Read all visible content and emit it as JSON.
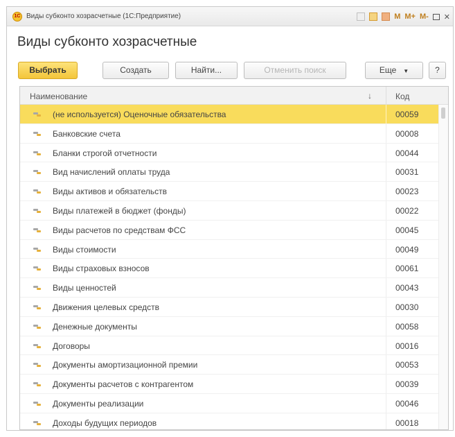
{
  "window": {
    "title": "Виды субконто хозрасчетные (1С:Предприятие)",
    "app_icon": "1c-logo-icon",
    "toolbar_icons": [
      "grid-icon",
      "calendar-icon",
      "calculator-icon"
    ],
    "memory_buttons": {
      "m": "M",
      "m_plus": "M+",
      "m_minus": "M-"
    },
    "minimize": "–",
    "close": "✕"
  },
  "form": {
    "title": "Виды субконто хозрасчетные"
  },
  "toolbar": {
    "select": "Выбрать",
    "create": "Создать",
    "find": "Найти...",
    "cancel_search": "Отменить поиск",
    "more": "Еще",
    "more_arrow": "▼",
    "help": "?"
  },
  "table": {
    "columns": {
      "name": "Наименование",
      "sort": "↓",
      "code": "Код"
    },
    "rows": [
      {
        "name": "(не используется) Оценочные обязательства",
        "code": "00059",
        "selected": true
      },
      {
        "name": "Банковские счета",
        "code": "00008"
      },
      {
        "name": "Бланки строгой отчетности",
        "code": "00044"
      },
      {
        "name": "Вид начислений оплаты труда",
        "code": "00031"
      },
      {
        "name": "Виды активов и обязательств",
        "code": "00023"
      },
      {
        "name": "Виды платежей в бюджет (фонды)",
        "code": "00022"
      },
      {
        "name": "Виды расчетов по средствам ФСС",
        "code": "00045"
      },
      {
        "name": "Виды стоимости",
        "code": "00049"
      },
      {
        "name": "Виды страховых взносов",
        "code": "00061"
      },
      {
        "name": "Виды ценностей",
        "code": "00043"
      },
      {
        "name": "Движения целевых средств",
        "code": "00030"
      },
      {
        "name": "Денежные документы",
        "code": "00058"
      },
      {
        "name": "Договоры",
        "code": "00016"
      },
      {
        "name": "Документы амортизационной премии",
        "code": "00053"
      },
      {
        "name": "Документы расчетов с контрагентом",
        "code": "00039"
      },
      {
        "name": "Документы реализации",
        "code": "00046"
      },
      {
        "name": "Доходы будущих периодов",
        "code": "00018"
      }
    ]
  }
}
